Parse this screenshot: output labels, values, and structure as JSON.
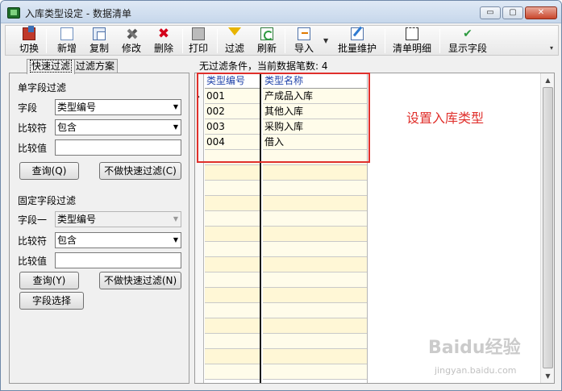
{
  "window": {
    "title": "入库类型设定 - 数据清单",
    "controls": {
      "minimize": "▭",
      "maximize": "▢",
      "close": "✕"
    }
  },
  "toolbar": {
    "items": [
      {
        "label": "切换",
        "icon": "switch-icon"
      },
      {
        "label": "新增",
        "icon": "new-document-icon"
      },
      {
        "label": "复制",
        "icon": "copy-icon"
      },
      {
        "label": "修改",
        "icon": "edit-tools-icon"
      },
      {
        "label": "删除",
        "icon": "delete-x-icon"
      },
      {
        "label": "打印",
        "icon": "printer-icon"
      },
      {
        "label": "过滤",
        "icon": "filter-funnel-icon"
      },
      {
        "label": "刷新",
        "icon": "refresh-icon"
      },
      {
        "label": "导入",
        "icon": "import-icon"
      },
      {
        "label": "批量维护",
        "icon": "batch-edit-icon"
      },
      {
        "label": "清单明细",
        "icon": "detail-list-icon"
      },
      {
        "label": "显示字段",
        "icon": "spellcheck-icon"
      }
    ],
    "delete_glyph": "✖",
    "fields_glyph": "✔",
    "dropdown_glyph": "▼",
    "more_glyph": "▾"
  },
  "left_panel": {
    "tabs": [
      {
        "label": "快速过滤",
        "active": true
      },
      {
        "label": "过滤方案",
        "active": false
      }
    ],
    "single_filter": {
      "section_title": "单字段过滤",
      "field_label": "字段",
      "field_value": "类型编号",
      "compare_label": "比较符",
      "compare_value": "包含",
      "value_label": "比较值",
      "value": "",
      "query_button": "查询(Q)",
      "no_filter_button": "不做快速过滤(C)"
    },
    "fixed_filter": {
      "section_title": "固定字段过滤",
      "field_label": "字段一",
      "field_value": "类型编号",
      "compare_label": "比较符",
      "compare_value": "包含",
      "value_label": "比较值",
      "value": "",
      "query_button": "查询(Y)",
      "no_filter_button": "不做快速过滤(N)",
      "select_fields_button": "字段选择"
    },
    "combo_arrow": "▼"
  },
  "grid": {
    "status": "无过滤条件，当前数据笔数: 4",
    "row_indicator": "›",
    "columns": [
      "类型编号",
      "类型名称"
    ],
    "rows": [
      {
        "code": "001",
        "name": "产成品入库"
      },
      {
        "code": "002",
        "name": "其他入库"
      },
      {
        "code": "003",
        "name": "采购入库"
      },
      {
        "code": "004",
        "name": "借入"
      }
    ],
    "annotation": "设置入库类型",
    "scroll_up": "▲",
    "scroll_down": "▼"
  },
  "watermark": {
    "text": "Baidu经验",
    "sub": "jingyan.baidu.com"
  },
  "colors": {
    "annotation": "#e0302c",
    "header_text": "#2244aa",
    "row_bg": "#fffcea"
  }
}
